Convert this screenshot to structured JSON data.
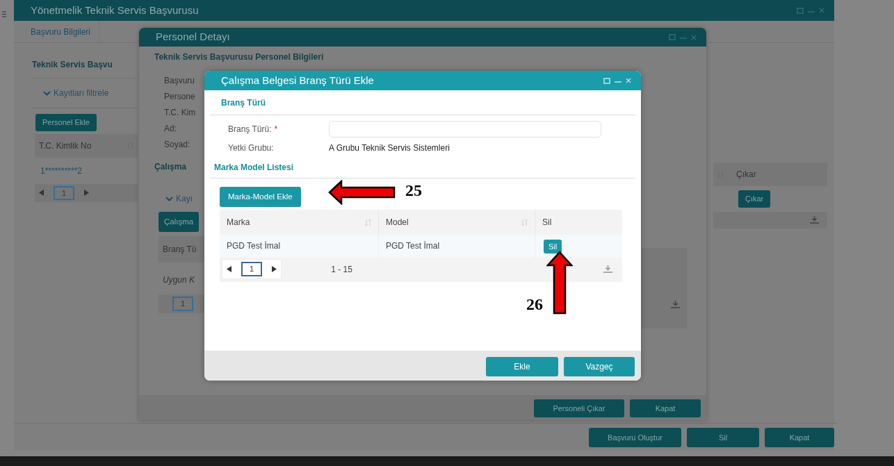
{
  "main_window": {
    "title": "Yönetmelik Teknik Servis Başvurusu",
    "tabs": [
      {
        "label": "Başvuru Bilgileri",
        "selected": true
      }
    ],
    "section_title": "Teknik Servis Başvu",
    "filter_label": "Kayıtları filtrele",
    "add_button": "Personel Ekle",
    "table": {
      "columns": [
        {
          "label": "T.C. Kimlik No",
          "sortable": true
        },
        {
          "label": "Çıkar",
          "sortable": false
        }
      ],
      "rows": [
        {
          "tc_no": "1**********2",
          "action": "Çıkar"
        }
      ],
      "page": "1"
    },
    "buttons": [
      "Başvuru Oluştur",
      "Sil",
      "Kapat"
    ]
  },
  "personnel_window": {
    "title": "Personel Detayı",
    "section_title": "Teknik Servis Başvurusu Personel Bilgileri",
    "fields": [
      "Başvuru",
      "Persone",
      "T.C. Kim",
      "Ad:",
      "Soyad:"
    ],
    "subsection_title": "Çalışma",
    "filter_label": "Kayı",
    "add_button": "Çalışma",
    "table": {
      "columns": [
        {
          "label": "Branş Tü",
          "sortable": false
        }
      ],
      "empty_text": "Uygun K",
      "page": "1"
    },
    "buttons": [
      "Personeli Çıkar",
      "Kapat"
    ]
  },
  "dialog": {
    "title": "Çalışma Belgesi Branş Türü Ekle",
    "section_title": "Branş Türü",
    "fields": [
      {
        "kind": "input",
        "label": "Branş Türü:",
        "required_mark": "*"
      },
      {
        "kind": "text",
        "label": "Yetki Grubu:",
        "value": "A Grubu Teknik Servis Sistemleri"
      }
    ],
    "list_title": "Marka Model Listesi",
    "add_button": "Marka-Model Ekle",
    "table": {
      "columns": [
        {
          "label": "Marka",
          "sortable": true
        },
        {
          "label": "Model",
          "sortable": true
        },
        {
          "label": "Sil",
          "sortable": false
        }
      ],
      "rows": [
        {
          "marka": "PGD Test İmal",
          "model": "PGD Test İmal",
          "action": "Sil"
        }
      ],
      "page": "1",
      "range": "1 - 15"
    },
    "buttons": [
      "Ekle",
      "Vazgeç"
    ]
  },
  "annotations": [
    {
      "label": "25",
      "kind": "left"
    },
    {
      "label": "26",
      "kind": "up"
    }
  ]
}
